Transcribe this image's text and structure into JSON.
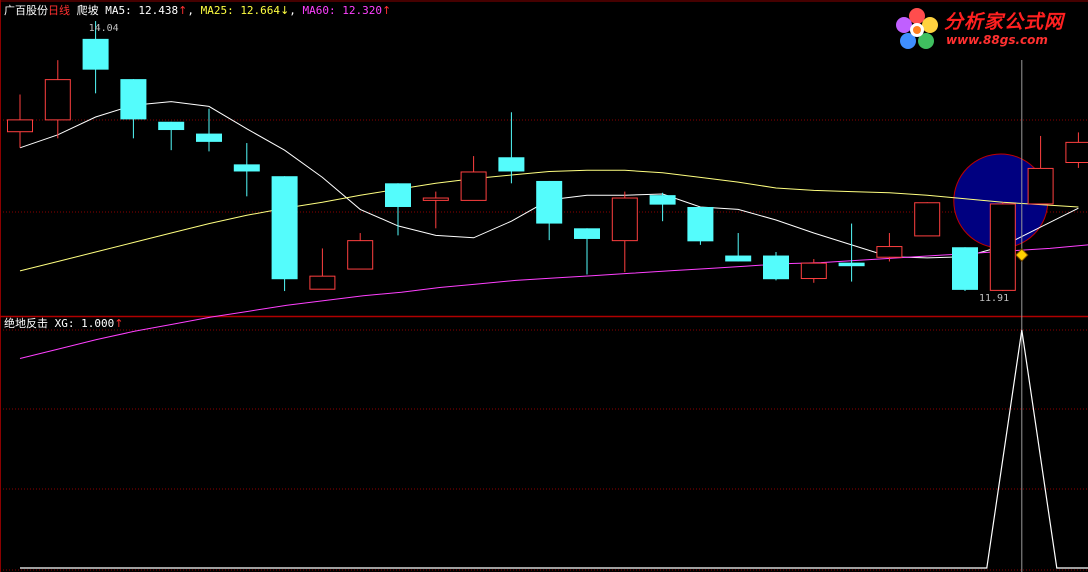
{
  "header": {
    "stock_name": "广百股份",
    "period": "日线",
    "indicator": "爬坡",
    "ma5_label": "MA5: 12.438",
    "ma25_label": "MA25: 12.664",
    "ma60_label": "MA60: 12.320",
    "up_arrow": "↑",
    "down_arrow": "↓",
    "comma": ","
  },
  "subheader": {
    "indicator": "绝地反击",
    "xg_label": "XG: 1.000",
    "up_arrow": "↑"
  },
  "logo": {
    "title": "分析家公式网",
    "url": "www.88gs.com"
  },
  "annotations": {
    "high_label": "14.04",
    "low_label": "11.91"
  },
  "colors": {
    "background": "#000000",
    "grid": "#8b0000",
    "up_candle": "#ff4040",
    "down_candle": "#54fcfc",
    "ma5": "#ffffff",
    "ma25": "#ffff80",
    "ma60": "#ff40ff",
    "signal_circle": "#000080",
    "xg_line": "#ffffff"
  },
  "chart_data": [
    {
      "type": "candlestick",
      "title": "",
      "ylim": [
        11.75,
        14.25
      ],
      "candles": [
        {
          "open": 13.26,
          "close": 13.36,
          "high": 13.57,
          "low": 13.12
        },
        {
          "open": 13.36,
          "close": 13.7,
          "high": 13.86,
          "low": 13.2
        },
        {
          "open": 14.04,
          "close": 13.78,
          "high": 14.19,
          "low": 13.58
        },
        {
          "open": 13.7,
          "close": 13.36,
          "high": 13.7,
          "low": 13.2
        },
        {
          "open": 13.34,
          "close": 13.27,
          "high": 13.34,
          "low": 13.1
        },
        {
          "open": 13.24,
          "close": 13.17,
          "high": 13.45,
          "low": 13.09
        },
        {
          "open": 12.98,
          "close": 12.92,
          "high": 13.16,
          "low": 12.71
        },
        {
          "open": 12.88,
          "close": 12.01,
          "high": 12.88,
          "low": 11.91
        },
        {
          "open": 11.93,
          "close": 12.04,
          "high": 12.27,
          "low": 11.93
        },
        {
          "open": 12.1,
          "close": 12.34,
          "high": 12.4,
          "low": 12.1
        },
        {
          "open": 12.82,
          "close": 12.62,
          "high": 12.82,
          "low": 12.38
        },
        {
          "open": 12.68,
          "close": 12.7,
          "high": 12.75,
          "low": 12.44
        },
        {
          "open": 12.68,
          "close": 12.92,
          "high": 13.05,
          "low": 12.68
        },
        {
          "open": 13.04,
          "close": 12.92,
          "high": 13.42,
          "low": 12.82
        },
        {
          "open": 12.84,
          "close": 12.48,
          "high": 12.84,
          "low": 12.34
        },
        {
          "open": 12.44,
          "close": 12.35,
          "high": 12.44,
          "low": 12.05
        },
        {
          "open": 12.34,
          "close": 12.7,
          "high": 12.75,
          "low": 12.07
        },
        {
          "open": 12.72,
          "close": 12.64,
          "high": 12.74,
          "low": 12.5
        },
        {
          "open": 12.62,
          "close": 12.33,
          "high": 12.62,
          "low": 12.3
        },
        {
          "open": 12.21,
          "close": 12.16,
          "high": 12.4,
          "low": 12.16
        },
        {
          "open": 12.21,
          "close": 12.01,
          "high": 12.24,
          "low": 12.0
        },
        {
          "open": 12.02,
          "close": 12.15,
          "high": 12.18,
          "low": 11.98
        },
        {
          "open": 12.15,
          "close": 12.12,
          "high": 12.48,
          "low": 11.99
        },
        {
          "open": 12.2,
          "close": 12.29,
          "high": 12.4,
          "low": 12.16
        },
        {
          "open": 12.38,
          "close": 12.66,
          "high": 12.66,
          "low": 12.38
        },
        {
          "open": 12.28,
          "close": 11.92,
          "high": 12.28,
          "low": 11.91
        },
        {
          "open": 11.92,
          "close": 12.65,
          "high": 12.66,
          "low": 11.91
        },
        {
          "open": 12.65,
          "close": 12.95,
          "high": 13.22,
          "low": 12.65
        },
        {
          "open": 13.0,
          "close": 13.17,
          "high": 13.25,
          "low": 12.95
        }
      ],
      "series": [
        {
          "name": "MA5",
          "values": [
            13.12,
            13.23,
            13.38,
            13.48,
            13.51,
            13.47,
            13.28,
            13.1,
            12.87,
            12.6,
            12.46,
            12.38,
            12.36,
            12.5,
            12.68,
            12.72,
            12.72,
            12.73,
            12.62,
            12.6,
            12.51,
            12.4,
            12.3,
            12.2,
            12.19,
            12.2,
            12.29,
            12.45,
            12.61
          ]
        },
        {
          "name": "MA25",
          "values": [
            12.08,
            12.16,
            12.24,
            12.32,
            12.4,
            12.48,
            12.55,
            12.61,
            12.66,
            12.72,
            12.77,
            12.82,
            12.86,
            12.89,
            12.92,
            12.93,
            12.93,
            12.91,
            12.87,
            12.83,
            12.78,
            12.76,
            12.75,
            12.74,
            12.72,
            12.69,
            12.66,
            12.64,
            12.62
          ]
        },
        {
          "name": "MA60",
          "values": [
            11.34,
            11.42,
            11.5,
            11.57,
            11.63,
            11.69,
            11.74,
            11.79,
            11.83,
            11.87,
            11.9,
            11.94,
            11.97,
            12.0,
            12.02,
            12.04,
            12.06,
            12.08,
            12.1,
            12.12,
            12.14,
            12.15,
            12.17,
            12.19,
            12.21,
            12.23,
            12.25,
            12.27,
            12.3
          ]
        }
      ],
      "signal_index": 26
    },
    {
      "type": "line",
      "title": "",
      "ylim": [
        0,
        1
      ],
      "series": [
        {
          "name": "XG",
          "values": [
            0,
            0,
            0,
            0,
            0,
            0,
            0,
            0,
            0,
            0,
            0,
            0,
            0,
            0,
            0,
            0,
            0,
            0,
            0,
            0,
            0,
            0,
            0,
            0,
            0,
            0,
            1,
            0,
            0
          ]
        }
      ]
    }
  ]
}
